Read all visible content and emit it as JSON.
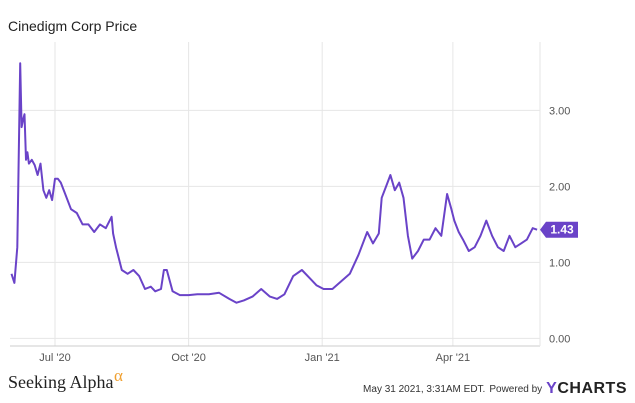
{
  "header": {
    "title": "Cinedigm Corp Price"
  },
  "footer": {
    "brand": "Seeking Alpha",
    "brand_mark": "α",
    "timestamp": "May 31 2021, 3:31AM EDT.",
    "powered_by": "Powered by",
    "logo_y": "Y",
    "logo_rest": "CHARTS"
  },
  "colors": {
    "series": "#6a43c8",
    "grid": "#e6e6e6",
    "brand_mark": "#f0a030"
  },
  "chart_data": {
    "type": "line",
    "title": "Cinedigm Corp Price",
    "xlabel": "",
    "ylabel": "",
    "y_ticks": [
      "0.00",
      "1.00",
      "2.00",
      "3.00"
    ],
    "x_ticks": [
      {
        "label": "Jul '20",
        "date": "2020-07-01"
      },
      {
        "label": "Oct '20",
        "date": "2020-10-01"
      },
      {
        "label": "Jan '21",
        "date": "2021-01-01"
      },
      {
        "label": "Apr '21",
        "date": "2021-04-01"
      }
    ],
    "xlim": [
      "2020-05-31",
      "2021-05-31"
    ],
    "ylim": [
      -0.1,
      3.9
    ],
    "grid": true,
    "last_value_label": "1.43",
    "series": [
      {
        "x": [
          "2020-06-01",
          "2020-06-03",
          "2020-06-05",
          "2020-06-07",
          "2020-06-08",
          "2020-06-09",
          "2020-06-10",
          "2020-06-11",
          "2020-06-12",
          "2020-06-13",
          "2020-06-15",
          "2020-06-17",
          "2020-06-19",
          "2020-06-21",
          "2020-06-23",
          "2020-06-25",
          "2020-06-27",
          "2020-06-29",
          "2020-07-01",
          "2020-07-03",
          "2020-07-05",
          "2020-07-08",
          "2020-07-12",
          "2020-07-16",
          "2020-07-20",
          "2020-07-24",
          "2020-07-28",
          "2020-08-01",
          "2020-08-05",
          "2020-08-09",
          "2020-08-10",
          "2020-08-12",
          "2020-08-16",
          "2020-08-20",
          "2020-08-24",
          "2020-08-28",
          "2020-09-01",
          "2020-09-05",
          "2020-09-08",
          "2020-09-12",
          "2020-09-14",
          "2020-09-16",
          "2020-09-20",
          "2020-09-25",
          "2020-10-01",
          "2020-10-07",
          "2020-10-15",
          "2020-10-22",
          "2020-10-29",
          "2020-11-03",
          "2020-11-08",
          "2020-11-14",
          "2020-11-20",
          "2020-11-26",
          "2020-12-01",
          "2020-12-06",
          "2020-12-12",
          "2020-12-18",
          "2020-12-24",
          "2020-12-28",
          "2021-01-02",
          "2021-01-08",
          "2021-01-14",
          "2021-01-20",
          "2021-01-26",
          "2021-02-01",
          "2021-02-05",
          "2021-02-09",
          "2021-02-11",
          "2021-02-14",
          "2021-02-17",
          "2021-02-20",
          "2021-02-23",
          "2021-02-26",
          "2021-03-01",
          "2021-03-04",
          "2021-03-08",
          "2021-03-12",
          "2021-03-16",
          "2021-03-20",
          "2021-03-24",
          "2021-03-28",
          "2021-03-31",
          "2021-04-02",
          "2021-04-05",
          "2021-04-08",
          "2021-04-12",
          "2021-04-16",
          "2021-04-20",
          "2021-04-24",
          "2021-04-28",
          "2021-05-02",
          "2021-05-06",
          "2021-05-10",
          "2021-05-14",
          "2021-05-18",
          "2021-05-22",
          "2021-05-26",
          "2021-05-29"
        ],
        "values": [
          0.85,
          0.73,
          1.2,
          3.62,
          2.78,
          2.88,
          2.95,
          2.35,
          2.45,
          2.3,
          2.35,
          2.28,
          2.15,
          2.3,
          1.95,
          1.85,
          1.95,
          1.82,
          2.1,
          2.1,
          2.05,
          1.9,
          1.7,
          1.65,
          1.5,
          1.5,
          1.4,
          1.5,
          1.45,
          1.6,
          1.38,
          1.2,
          0.9,
          0.85,
          0.9,
          0.82,
          0.65,
          0.68,
          0.62,
          0.65,
          0.9,
          0.9,
          0.62,
          0.57,
          0.57,
          0.58,
          0.58,
          0.6,
          0.52,
          0.47,
          0.5,
          0.55,
          0.65,
          0.55,
          0.52,
          0.58,
          0.82,
          0.9,
          0.78,
          0.7,
          0.65,
          0.65,
          0.75,
          0.85,
          1.1,
          1.4,
          1.25,
          1.38,
          1.85,
          2.0,
          2.15,
          1.95,
          2.05,
          1.85,
          1.35,
          1.05,
          1.15,
          1.3,
          1.3,
          1.45,
          1.35,
          1.9,
          1.7,
          1.55,
          1.4,
          1.3,
          1.15,
          1.2,
          1.35,
          1.55,
          1.35,
          1.2,
          1.15,
          1.35,
          1.2,
          1.25,
          1.3,
          1.45,
          1.43
        ]
      }
    ]
  }
}
